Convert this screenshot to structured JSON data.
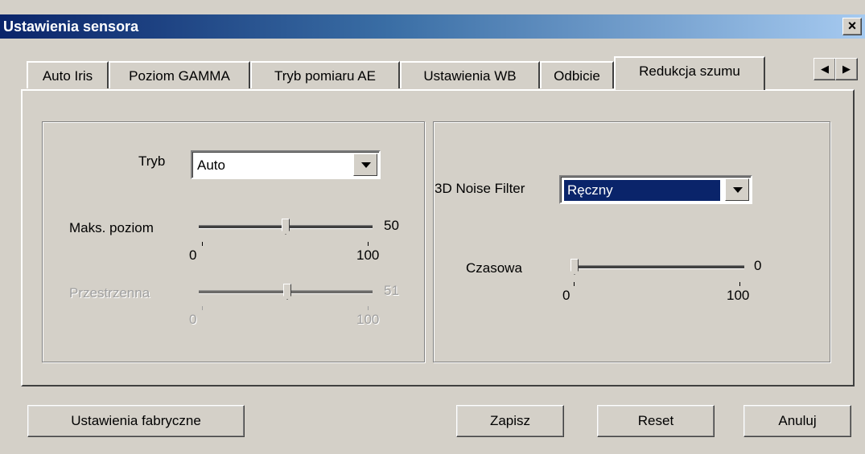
{
  "window": {
    "title": "Ustawienia sensora",
    "close": "×"
  },
  "tabs": [
    {
      "label": "Auto Iris"
    },
    {
      "label": "Poziom GAMMA"
    },
    {
      "label": "Tryb pomiaru AE"
    },
    {
      "label": "Ustawienia WB"
    },
    {
      "label": "Odbicie"
    },
    {
      "label": "Redukcja szumu",
      "active": true
    }
  ],
  "tab_scroll": {
    "left": "◀",
    "right": "▶"
  },
  "left_group": {
    "mode_label": "Tryb",
    "mode_value": "Auto",
    "max_level": {
      "label": "Maks. poziom",
      "value": "50",
      "min": "0",
      "max": "100",
      "level": 50
    },
    "spatial": {
      "label": "Przestrzenna",
      "value": "51",
      "min": "0",
      "max": "100",
      "level": 51,
      "disabled": true
    }
  },
  "right_group": {
    "filter_label": "3D Noise Filter",
    "filter_value": "Ręczny",
    "temporal": {
      "label": "Czasowa",
      "value": "0",
      "min": "0",
      "max": "100",
      "level": 0
    }
  },
  "buttons": {
    "factory": "Ustawienia fabryczne",
    "save": "Zapisz",
    "reset": "Reset",
    "cancel": "Anuluj"
  }
}
